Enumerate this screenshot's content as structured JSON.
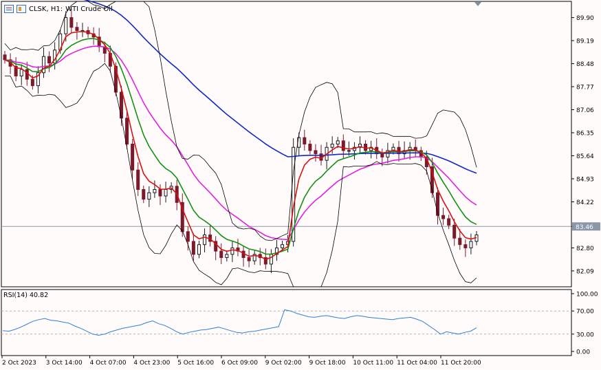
{
  "header": {
    "symbol": "CLSK, H1:",
    "subtitle": "WTI Crude Oil"
  },
  "price_axis": {
    "ticks": [
      "89.90",
      "89.19",
      "88.48",
      "87.77",
      "87.06",
      "86.35",
      "85.64",
      "84.93",
      "84.22",
      "83.46",
      "82.80",
      "82.09"
    ],
    "current_price": "83.46"
  },
  "rsi": {
    "label": "RSI(14) 40.82",
    "ticks": [
      "100.00",
      "70.00",
      "30.00",
      "0.00"
    ]
  },
  "time_axis": {
    "labels": [
      "2 Oct 2023",
      "3 Oct 14:00",
      "4 Oct 07:00",
      "4 Oct 23:00",
      "5 Oct 16:00",
      "6 Oct 09:00",
      "9 Oct 02:00",
      "9 Oct 18:00",
      "10 Oct 11:00",
      "11 Oct 04:00",
      "11 Oct 20:00"
    ]
  },
  "colors": {
    "ma_fast": "#d81010",
    "ma_mid": "#129012",
    "ma_slow": "#e020e0",
    "ma_long": "#1028c8",
    "bull_candle": "#1a1a1a",
    "bear_candle": "#7a1a2a",
    "rsi_line": "#2f7fd8"
  },
  "chart_data": {
    "type": "candlestick",
    "ylim": [
      81.6,
      90.4
    ],
    "close": [
      88.6,
      88.4,
      88.1,
      88.3,
      88.0,
      87.8,
      88.2,
      88.7,
      88.5,
      88.9,
      89.4,
      89.9,
      89.6,
      89.5,
      89.5,
      89.4,
      89.3,
      89.0,
      88.8,
      88.4,
      87.6,
      86.8,
      86.0,
      85.2,
      84.6,
      84.3,
      84.5,
      84.6,
      84.4,
      84.6,
      84.7,
      84.2,
      83.3,
      83.0,
      82.6,
      82.9,
      83.2,
      83.0,
      82.7,
      82.5,
      82.6,
      82.8,
      82.7,
      82.5,
      82.4,
      82.6,
      82.5,
      82.3,
      82.6,
      82.8,
      82.9,
      83.0,
      85.9,
      86.2,
      86.0,
      85.8,
      85.7,
      85.5,
      85.9,
      86.0,
      86.1,
      85.8,
      85.8,
      85.9,
      86.0,
      85.8,
      85.9,
      85.7,
      85.6,
      85.8,
      85.9,
      85.7,
      85.8,
      85.9,
      85.8,
      85.6,
      85.3,
      84.5,
      83.8,
      83.7,
      83.5,
      83.1,
      82.9,
      82.8,
      83.0,
      83.2
    ],
    "rsi": [
      36,
      35,
      38,
      42,
      47,
      52,
      55,
      57,
      54,
      53,
      51,
      49,
      44,
      40,
      35,
      30,
      28,
      30,
      34,
      37,
      40,
      42,
      44,
      46,
      50,
      53,
      48,
      45,
      40,
      34,
      30,
      33,
      35,
      37,
      38,
      40,
      42,
      39,
      36,
      33,
      32,
      34,
      35,
      37,
      39,
      41,
      43,
      72,
      70,
      66,
      63,
      60,
      59,
      61,
      62,
      60,
      58,
      57,
      60,
      62,
      61,
      59,
      58,
      57,
      56,
      55,
      57,
      58,
      59,
      56,
      52,
      45,
      38,
      30,
      34,
      32,
      30,
      33,
      35,
      41
    ]
  }
}
